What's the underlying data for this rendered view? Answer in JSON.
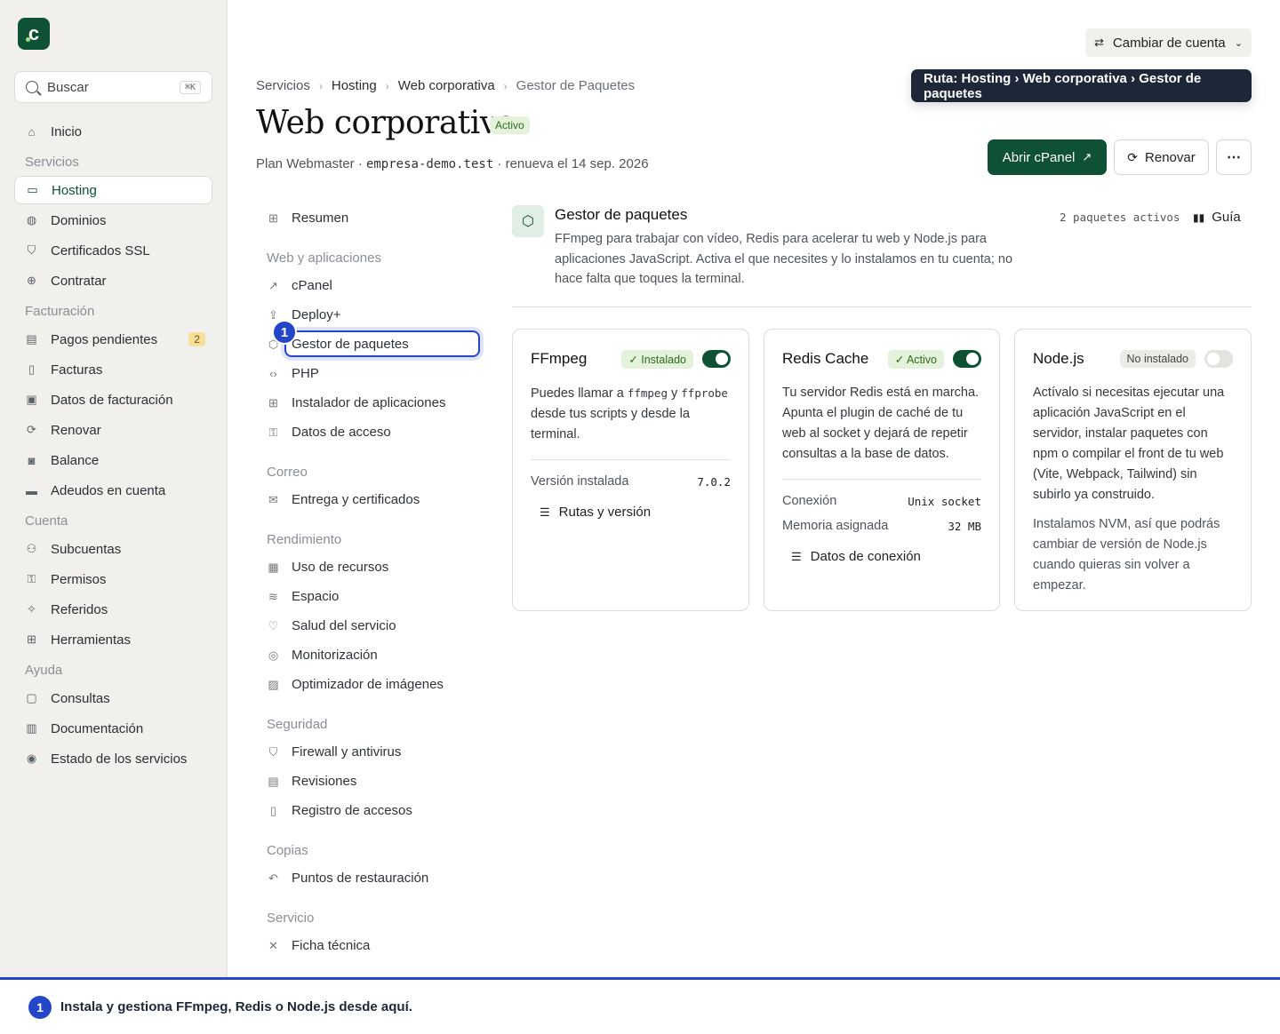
{
  "sidebar": {
    "logo_letter": "c",
    "search": {
      "placeholder": "Buscar",
      "shortcut": "⌘K"
    },
    "items": [
      {
        "type": "item",
        "label": "Inicio",
        "icon": "home-icon"
      },
      {
        "type": "section",
        "label": "Servicios"
      },
      {
        "type": "item",
        "label": "Hosting",
        "icon": "server-icon",
        "active": true
      },
      {
        "type": "item",
        "label": "Dominios",
        "icon": "globe-icon"
      },
      {
        "type": "item",
        "label": "Certificados SSL",
        "icon": "shield-icon"
      },
      {
        "type": "item",
        "label": "Contratar",
        "icon": "plus-circle-icon"
      },
      {
        "type": "section",
        "label": "Facturación"
      },
      {
        "type": "item",
        "label": "Pagos pendientes",
        "icon": "wallet-icon",
        "badge": "2"
      },
      {
        "type": "item",
        "label": "Facturas",
        "icon": "file-icon"
      },
      {
        "type": "item",
        "label": "Datos de facturación",
        "icon": "id-card-icon"
      },
      {
        "type": "item",
        "label": "Renovar",
        "icon": "refresh-icon"
      },
      {
        "type": "item",
        "label": "Balance",
        "icon": "balance-icon"
      },
      {
        "type": "item",
        "label": "Adeudos en cuenta",
        "icon": "credit-card-icon"
      },
      {
        "type": "section",
        "label": "Cuenta"
      },
      {
        "type": "item",
        "label": "Subcuentas",
        "icon": "users-icon"
      },
      {
        "type": "item",
        "label": "Permisos",
        "icon": "key-icon"
      },
      {
        "type": "item",
        "label": "Referidos",
        "icon": "sparkle-icon"
      },
      {
        "type": "item",
        "label": "Herramientas",
        "icon": "grid-icon"
      },
      {
        "type": "section",
        "label": "Ayuda"
      },
      {
        "type": "item",
        "label": "Consultas",
        "icon": "chat-icon"
      },
      {
        "type": "item",
        "label": "Documentación",
        "icon": "book-icon"
      },
      {
        "type": "item",
        "label": "Estado de los servicios",
        "icon": "broadcast-icon"
      }
    ]
  },
  "header": {
    "switch_account": "Cambiar de cuenta",
    "tooltip": "Ruta: Hosting › Web corporativa › Gestor de paquetes",
    "breadcrumb": [
      "Servicios",
      "Hosting",
      "Web corporativa",
      "Gestor de Paquetes"
    ],
    "title": "Web corporativa",
    "status": "Activo",
    "plan": "Plan Webmaster",
    "domain": "empresa-demo.test",
    "renews": "renueva el 14 sep. 2026",
    "open_cpanel": "Abrir cPanel",
    "renew": "Renovar",
    "more": "⋯"
  },
  "subnav": [
    {
      "type": "item",
      "label": "Resumen",
      "icon": "grid-icon"
    },
    {
      "type": "section",
      "label": "Web y aplicaciones"
    },
    {
      "type": "item",
      "label": "cPanel",
      "icon": "external-icon"
    },
    {
      "type": "item",
      "label": "Deploy+",
      "icon": "upload-icon"
    },
    {
      "type": "item",
      "label": "Gestor de paquetes",
      "icon": "package-icon",
      "active": true
    },
    {
      "type": "item",
      "label": "PHP",
      "icon": "code-icon"
    },
    {
      "type": "item",
      "label": "Instalador de aplicaciones",
      "icon": "grid-icon"
    },
    {
      "type": "item",
      "label": "Datos de acceso",
      "icon": "key-icon"
    },
    {
      "type": "section",
      "label": "Correo"
    },
    {
      "type": "item",
      "label": "Entrega y certificados",
      "icon": "mail-icon"
    },
    {
      "type": "section",
      "label": "Rendimiento"
    },
    {
      "type": "item",
      "label": "Uso de recursos",
      "icon": "chart-icon"
    },
    {
      "type": "item",
      "label": "Espacio",
      "icon": "database-icon"
    },
    {
      "type": "item",
      "label": "Salud del servicio",
      "icon": "heart-icon"
    },
    {
      "type": "item",
      "label": "Monitorización",
      "icon": "eye-icon"
    },
    {
      "type": "item",
      "label": "Optimizador de imágenes",
      "icon": "image-icon"
    },
    {
      "type": "section",
      "label": "Seguridad"
    },
    {
      "type": "item",
      "label": "Firewall y antivirus",
      "icon": "shield-icon"
    },
    {
      "type": "item",
      "label": "Revisiones",
      "icon": "clipboard-icon"
    },
    {
      "type": "item",
      "label": "Registro de accesos",
      "icon": "file-icon"
    },
    {
      "type": "section",
      "label": "Copias"
    },
    {
      "type": "item",
      "label": "Puntos de restauración",
      "icon": "undo-icon"
    },
    {
      "type": "section",
      "label": "Servicio"
    },
    {
      "type": "item",
      "label": "Ficha técnica",
      "icon": "tools-icon"
    }
  ],
  "step_marker": "1",
  "package_manager": {
    "title": "Gestor de paquetes",
    "description": "FFmpeg para trabajar con vídeo, Redis para acelerar tu web y Node.js para aplicaciones JavaScript. Activa el que necesites y lo instalamos en tu cuenta; no hace falta que toques la terminal.",
    "count": "2 paquetes activos",
    "guide": "Guía"
  },
  "cards": {
    "ffmpeg": {
      "name": "FFmpeg",
      "status": "✓ Instalado",
      "enabled": true,
      "text_pre": "Puedes llamar a ",
      "code1": "ffmpeg",
      "text_mid": " y ",
      "code2": "ffprobe",
      "text_post": " desde tus scripts y desde la terminal.",
      "kv": [
        {
          "k": "Versión instalada",
          "v": "7.0.2"
        }
      ],
      "action": "Rutas y versión"
    },
    "redis": {
      "name": "Redis Cache",
      "status": "✓ Activo",
      "enabled": true,
      "text": "Tu servidor Redis está en marcha. Apunta el plugin de caché de tu web al socket y dejará de repetir consultas a la base de datos.",
      "kv": [
        {
          "k": "Conexión",
          "v": "Unix socket"
        },
        {
          "k": "Memoria asignada",
          "v": "32 MB"
        }
      ],
      "action": "Datos de conexión"
    },
    "node": {
      "name": "Node.js",
      "status": "No instalado",
      "enabled": false,
      "text": "Actívalo si necesitas ejecutar una aplicación JavaScript en el servidor, instalar paquetes con npm o compilar el front de tu web (Vite, Webpack, Tailwind) sin subirlo ya construido.",
      "text2": "Instalamos NVM, así que podrás cambiar de versión de Node.js cuando quieras sin volver a empezar."
    }
  },
  "bottom_tip": {
    "number": "1",
    "text": "Instala y gestiona FFmpeg, Redis o Node.js desde aquí."
  }
}
